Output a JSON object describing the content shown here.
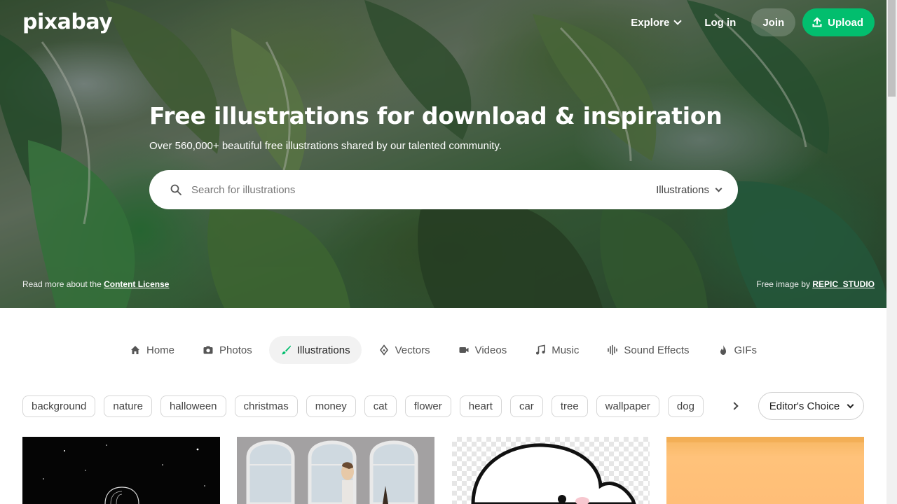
{
  "brand": {
    "logo_text": "pixabay"
  },
  "nav": {
    "explore": "Explore",
    "login": "Log in",
    "join": "Join",
    "upload": "Upload"
  },
  "hero": {
    "title": "Free illustrations for download & inspiration",
    "subtitle": "Over 560,000+ beautiful free illustrations shared by our talented community.",
    "search_placeholder": "Search for illustrations",
    "search_type": "Illustrations",
    "license_prefix": "Read more about the",
    "license_link": "Content License",
    "credit_prefix": "Free image by",
    "credit_author": "REPIC_STUDIO"
  },
  "tabs": [
    {
      "label": "Home",
      "icon": "home-icon"
    },
    {
      "label": "Photos",
      "icon": "camera-icon"
    },
    {
      "label": "Illustrations",
      "icon": "brush-icon",
      "active": true
    },
    {
      "label": "Vectors",
      "icon": "pen-nib-icon"
    },
    {
      "label": "Videos",
      "icon": "video-camera-icon"
    },
    {
      "label": "Music",
      "icon": "music-note-icon"
    },
    {
      "label": "Sound Effects",
      "icon": "waveform-icon"
    },
    {
      "label": "GIFs",
      "icon": "flame-icon"
    }
  ],
  "tags": [
    "background",
    "nature",
    "halloween",
    "christmas",
    "money",
    "cat",
    "flower",
    "heart",
    "car",
    "tree",
    "wallpaper",
    "dog"
  ],
  "sort": {
    "label": "Editor's Choice"
  },
  "colors": {
    "accent": "#02be6e",
    "active_tab_bg": "#f2f2f2"
  }
}
